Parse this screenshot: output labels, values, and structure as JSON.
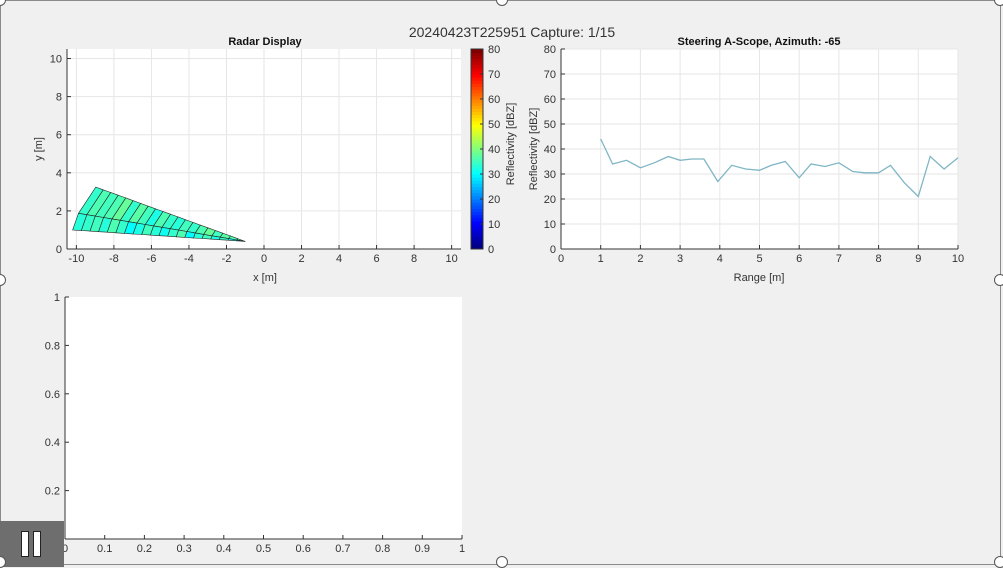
{
  "suptitle": "20240423T225951 Capture: 1/15",
  "radar": {
    "title": "Radar Display",
    "xlabel": "x [m]",
    "ylabel": "y [m]",
    "xticks": [
      "-10",
      "-8",
      "-6",
      "-4",
      "-2",
      "0",
      "2",
      "4",
      "6",
      "8",
      "10"
    ],
    "yticks": [
      "0",
      "2",
      "4",
      "6",
      "8",
      "10"
    ],
    "colorbar": {
      "label": "Reflectivity [dBZ]",
      "ticks": [
        "0",
        "10",
        "20",
        "30",
        "40",
        "50",
        "60",
        "70",
        "80"
      ]
    }
  },
  "ascope": {
    "title": "Steering A-Scope, Azimuth: -65",
    "xlabel": "Range [m]",
    "ylabel": "Reflectivity [dBZ]",
    "xticks": [
      "0",
      "1",
      "2",
      "3",
      "4",
      "5",
      "6",
      "7",
      "8",
      "9",
      "10"
    ],
    "yticks": [
      "0",
      "10",
      "20",
      "30",
      "40",
      "50",
      "60",
      "70",
      "80"
    ]
  },
  "empty_axes": {
    "xticks": [
      "0",
      "0.1",
      "0.2",
      "0.3",
      "0.4",
      "0.5",
      "0.6",
      "0.7",
      "0.8",
      "0.9",
      "1"
    ],
    "yticks": [
      "0",
      "0.2",
      "0.4",
      "0.6",
      "0.8",
      "1"
    ]
  },
  "controls": {
    "pause_icon": "pause-icon"
  },
  "chart_data": [
    {
      "type": "heatmap",
      "title": "Radar Display",
      "xlabel": "x [m]",
      "ylabel": "y [m]",
      "xlim": [
        -10.5,
        10.5
      ],
      "ylim": [
        0,
        10.5
      ],
      "colorbar_label": "Reflectivity [dBZ]",
      "clim": [
        0,
        80
      ],
      "colormap": "jet",
      "sector": {
        "origin": [
          -1,
          0.4
        ],
        "azimuth_deg": [
          -25,
          0
        ],
        "range_m": [
          0,
          10
        ],
        "note": "wedge extends toward negative x"
      },
      "azimuth_sweeps": [
        [
          34,
          36,
          37,
          35,
          38,
          36,
          34,
          35,
          33,
          34,
          36,
          32,
          35,
          37,
          34,
          38,
          36,
          35,
          36,
          34
        ],
        [
          28,
          30,
          34,
          32,
          35,
          33,
          30,
          36,
          34,
          31,
          33,
          35,
          32,
          30,
          34,
          36,
          33,
          35,
          34,
          33
        ],
        [
          35,
          38,
          36,
          40,
          37,
          35,
          38,
          36,
          39,
          37,
          36,
          34,
          38,
          35,
          37,
          39,
          36,
          38,
          37,
          36
        ]
      ]
    },
    {
      "type": "line",
      "title": "Steering A-Scope, Azimuth: -65",
      "xlabel": "Range [m]",
      "ylabel": "Reflectivity [dBZ]",
      "xlim": [
        0,
        10
      ],
      "ylim": [
        0,
        80
      ],
      "grid": true,
      "color": "#7fb6c4",
      "x": [
        1.0,
        1.3,
        1.65,
        2.0,
        2.35,
        2.7,
        3.0,
        3.3,
        3.6,
        3.95,
        4.3,
        4.65,
        5.0,
        5.3,
        5.65,
        6.0,
        6.3,
        6.65,
        7.0,
        7.35,
        7.65,
        8.0,
        8.3,
        8.65,
        9.0,
        9.3,
        9.65,
        10.0
      ],
      "y": [
        44,
        34,
        35.5,
        32.5,
        34.5,
        37,
        35.5,
        36,
        36,
        27,
        33.5,
        32,
        31.5,
        33.5,
        35,
        28.5,
        34,
        33,
        34.5,
        31,
        30.5,
        30.5,
        33.5,
        26.5,
        21,
        37,
        32,
        36.5
      ]
    },
    {
      "type": "line",
      "title": "",
      "xlim": [
        0,
        1
      ],
      "ylim": [
        0,
        1
      ],
      "x": [],
      "y": []
    }
  ]
}
